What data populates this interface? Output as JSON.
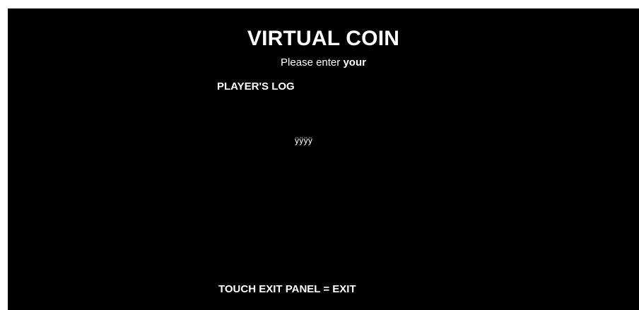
{
  "screen": {
    "title": "VIRTUAL COIN",
    "prompt_text": "Please enter ",
    "prompt_bold": "your",
    "field_label": "PLAYER'S LOG",
    "entry_value": "ÿÿÿÿ",
    "exit_hint": "TOUCH EXIT PANEL = EXIT"
  },
  "colors": {
    "background": "#000000",
    "text": "#ffffff"
  }
}
